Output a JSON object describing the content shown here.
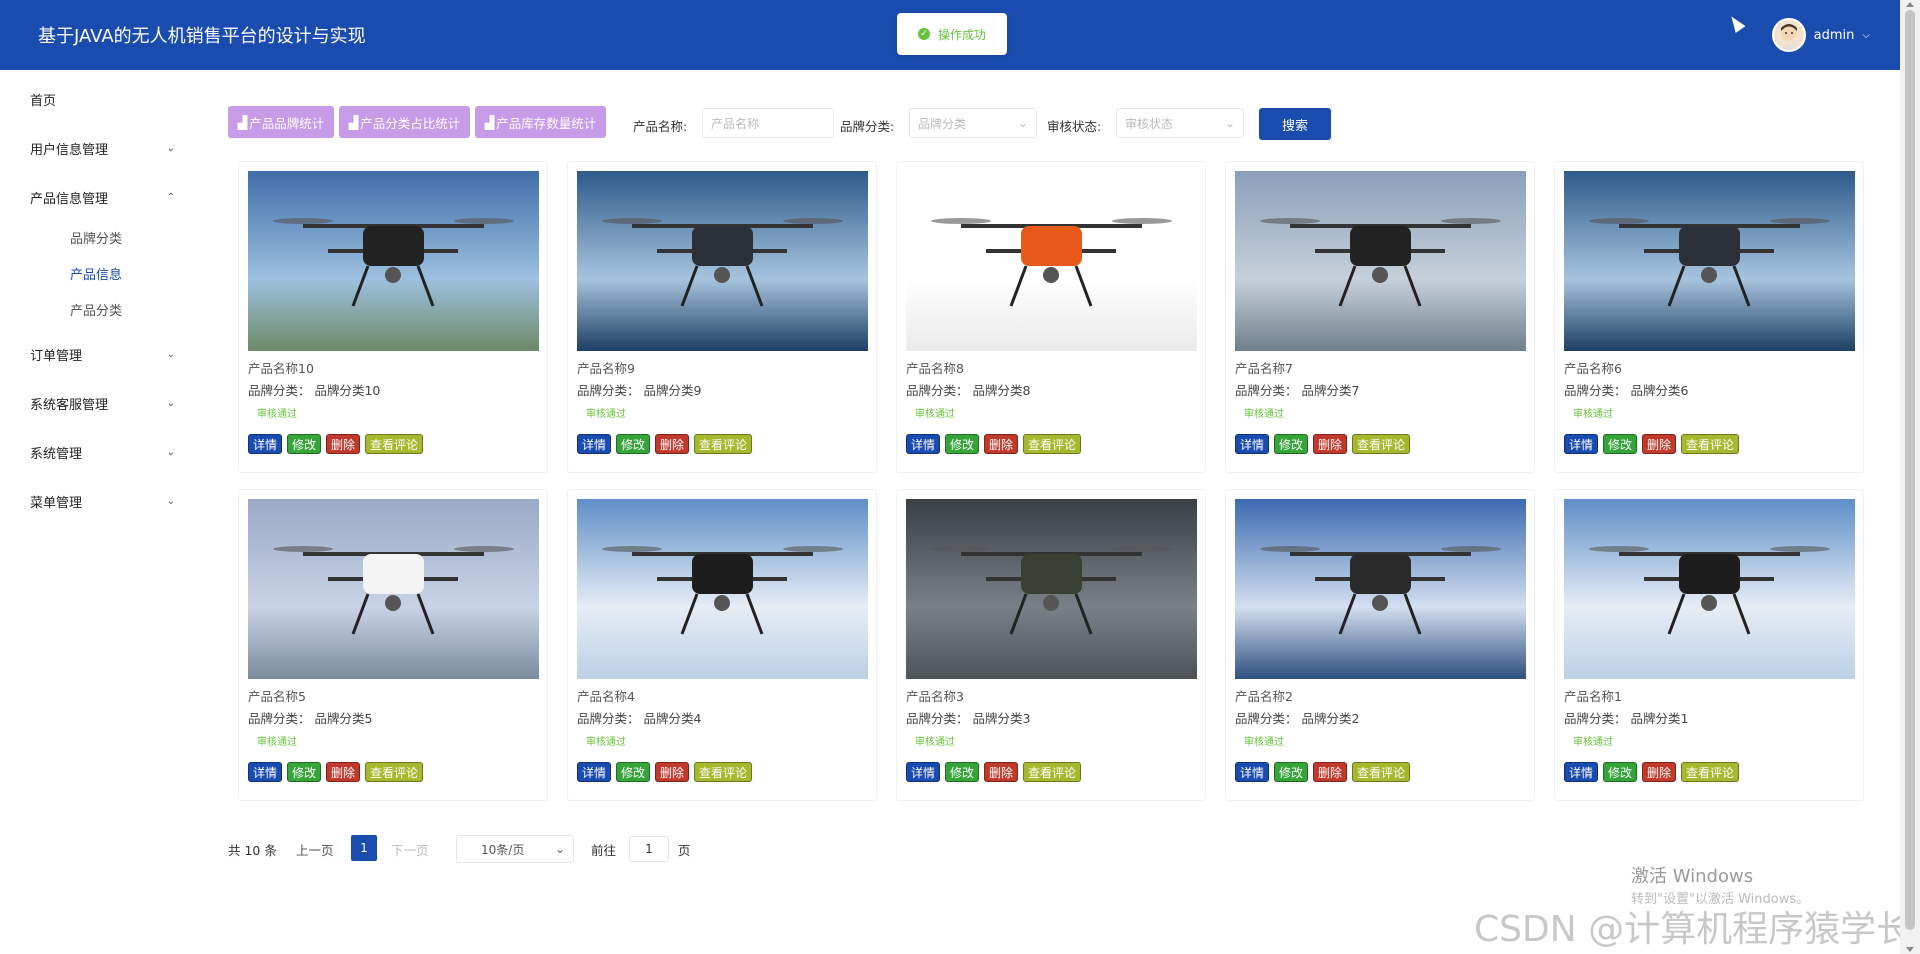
{
  "header": {
    "title": "基于JAVA的无人机销售平台的设计与实现",
    "toast": "操作成功",
    "username": "admin"
  },
  "sidebar": {
    "items": [
      {
        "label": "首页"
      },
      {
        "label": "用户信息管理"
      },
      {
        "label": "产品信息管理"
      },
      {
        "label": "订单管理"
      },
      {
        "label": "系统客服管理"
      },
      {
        "label": "系统管理"
      },
      {
        "label": "菜单管理"
      }
    ],
    "subitems": [
      {
        "label": "品牌分类"
      },
      {
        "label": "产品信息",
        "active": true
      },
      {
        "label": "产品分类"
      }
    ]
  },
  "toolbar": {
    "stat_buttons": [
      "产品品牌统计",
      "产品分类占比统计",
      "产品库存数量统计"
    ],
    "name_label": "产品名称:",
    "name_placeholder": "产品名称",
    "brand_label": "品牌分类:",
    "brand_placeholder": "品牌分类",
    "status_label": "审核状态:",
    "status_placeholder": "审核状态",
    "search_label": "搜索"
  },
  "actions": {
    "detail": "详情",
    "edit": "修改",
    "delete": "删除",
    "comments": "查看评论"
  },
  "products": [
    {
      "name": "产品名称10",
      "brand": "品牌分类：  品牌分类10",
      "status": "审核通过"
    },
    {
      "name": "产品名称9",
      "brand": "品牌分类：  品牌分类9",
      "status": "审核通过"
    },
    {
      "name": "产品名称8",
      "brand": "品牌分类：  品牌分类8",
      "status": "审核通过"
    },
    {
      "name": "产品名称7",
      "brand": "品牌分类：  品牌分类7",
      "status": "审核通过"
    },
    {
      "name": "产品名称6",
      "brand": "品牌分类：  品牌分类6",
      "status": "审核通过"
    },
    {
      "name": "产品名称5",
      "brand": "品牌分类：  品牌分类5",
      "status": "审核通过"
    },
    {
      "name": "产品名称4",
      "brand": "品牌分类：  品牌分类4",
      "status": "审核通过"
    },
    {
      "name": "产品名称3",
      "brand": "品牌分类：  品牌分类3",
      "status": "审核通过"
    },
    {
      "name": "产品名称2",
      "brand": "品牌分类：  品牌分类2",
      "status": "审核通过"
    },
    {
      "name": "产品名称1",
      "brand": "品牌分类：  品牌分类1",
      "status": "审核通过"
    }
  ],
  "pagination": {
    "total": "共 10 条",
    "prev": "上一页",
    "current": "1",
    "next": "下一页",
    "page_size": "10条/页",
    "goto_label": "前往",
    "goto_value": "1",
    "page_unit": "页"
  },
  "overlay": {
    "windows_activation": "激活 Windows",
    "windows_hint": "转到\"设置\"以激活 Windows。",
    "watermark": "CSDN @计算机程序猿学长"
  },
  "colors": {
    "primary": "#1a4cb0",
    "stat_button": "#c79be8",
    "success": "#67c23a"
  }
}
